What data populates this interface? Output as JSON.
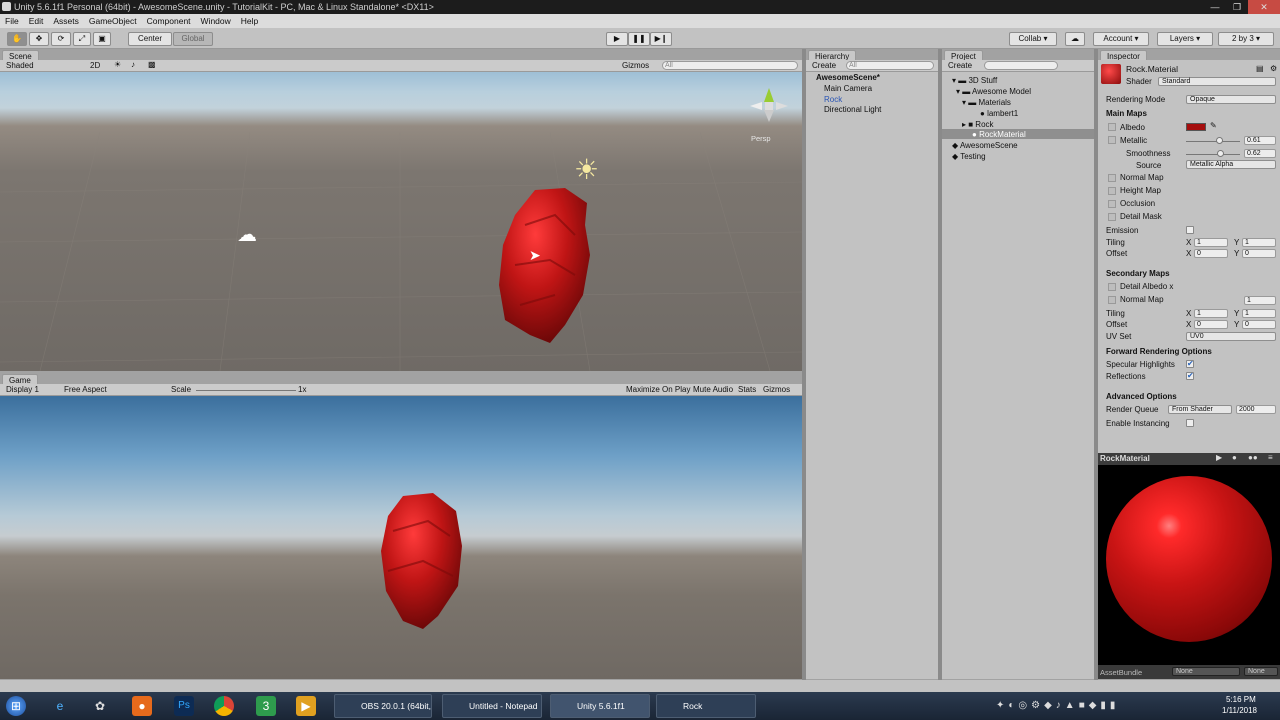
{
  "window": {
    "title": "Unity 5.6.1f1 Personal (64bit) - AwesomeScene.unity - TutorialKit - PC, Mac & Linux Standalone* <DX11>"
  },
  "menu": [
    "File",
    "Edit",
    "Assets",
    "GameObject",
    "Component",
    "Window",
    "Help"
  ],
  "toolbar": {
    "center": "Center",
    "global": "Global",
    "collab": "Collab",
    "account": "Account",
    "layers": "Layers",
    "layout": "2 by 3"
  },
  "scene": {
    "tab": "Scene",
    "shading": "Shaded",
    "mode2d": "2D",
    "gizmos": "Gizmos",
    "search": "All",
    "persp": "Persp"
  },
  "game": {
    "tab": "Game",
    "display": "Display 1",
    "aspect": "Free Aspect",
    "scale": "Scale",
    "scale_value": "1x",
    "maximize": "Maximize On Play",
    "mute": "Mute Audio",
    "stats": "Stats",
    "gizmos": "Gizmos"
  },
  "hierarchy": {
    "tab": "Hierarchy",
    "create": "Create",
    "search": "All",
    "scene": "AwesomeScene*",
    "items": [
      "Main Camera",
      "Rock",
      "Directional Light"
    ]
  },
  "project": {
    "tab": "Project",
    "create": "Create",
    "items": [
      "3D Stuff",
      "Awesome Model",
      "Materials",
      "lambert1",
      "Rock",
      "RockMaterial",
      "AwesomeScene",
      "Testing"
    ]
  },
  "inspector": {
    "tab": "Inspector",
    "material_name": "Rock.Material",
    "shader_label": "Shader",
    "shader": "Standard",
    "rendering_mode_label": "Rendering Mode",
    "rendering_mode": "Opaque",
    "main_maps": "Main Maps",
    "albedo": "Albedo",
    "albedo_color": "#a50e0e",
    "metallic": "Metallic",
    "metallic_value": "0.61",
    "smoothness": "Smoothness",
    "smoothness_value": "0.62",
    "source": "Source",
    "source_value": "Metallic Alpha",
    "normal_map": "Normal Map",
    "height_map": "Height Map",
    "occlusion": "Occlusion",
    "detail_mask": "Detail Mask",
    "emission": "Emission",
    "tiling": "Tiling",
    "offset": "Offset",
    "x": "X",
    "y": "Y",
    "one": "1",
    "zero": "0",
    "secondary_maps": "Secondary Maps",
    "detail_albedo": "Detail Albedo x",
    "normal_map2": "Normal Map",
    "normal_map2_value": "1",
    "uv_set": "UV Set",
    "uv_set_value": "UV0",
    "forward_options": "Forward Rendering Options",
    "specular": "Specular Highlights",
    "reflections": "Reflections",
    "advanced": "Advanced Options",
    "render_queue": "Render Queue",
    "render_queue_mode": "From Shader",
    "render_queue_value": "2000",
    "instancing": "Enable Instancing",
    "preview_title": "RockMaterial",
    "assetbundle": "AssetBundle",
    "assetbundle_value": "None",
    "assetbundle_value2": "None"
  },
  "taskbar": {
    "items": [
      "OBS 20.0.1 (64bit, ...",
      "Untitled - Notepad",
      "Unity 5.6.1f1 Pers...",
      "Rock"
    ],
    "time": "5:16 PM",
    "date": "1/11/2018"
  }
}
